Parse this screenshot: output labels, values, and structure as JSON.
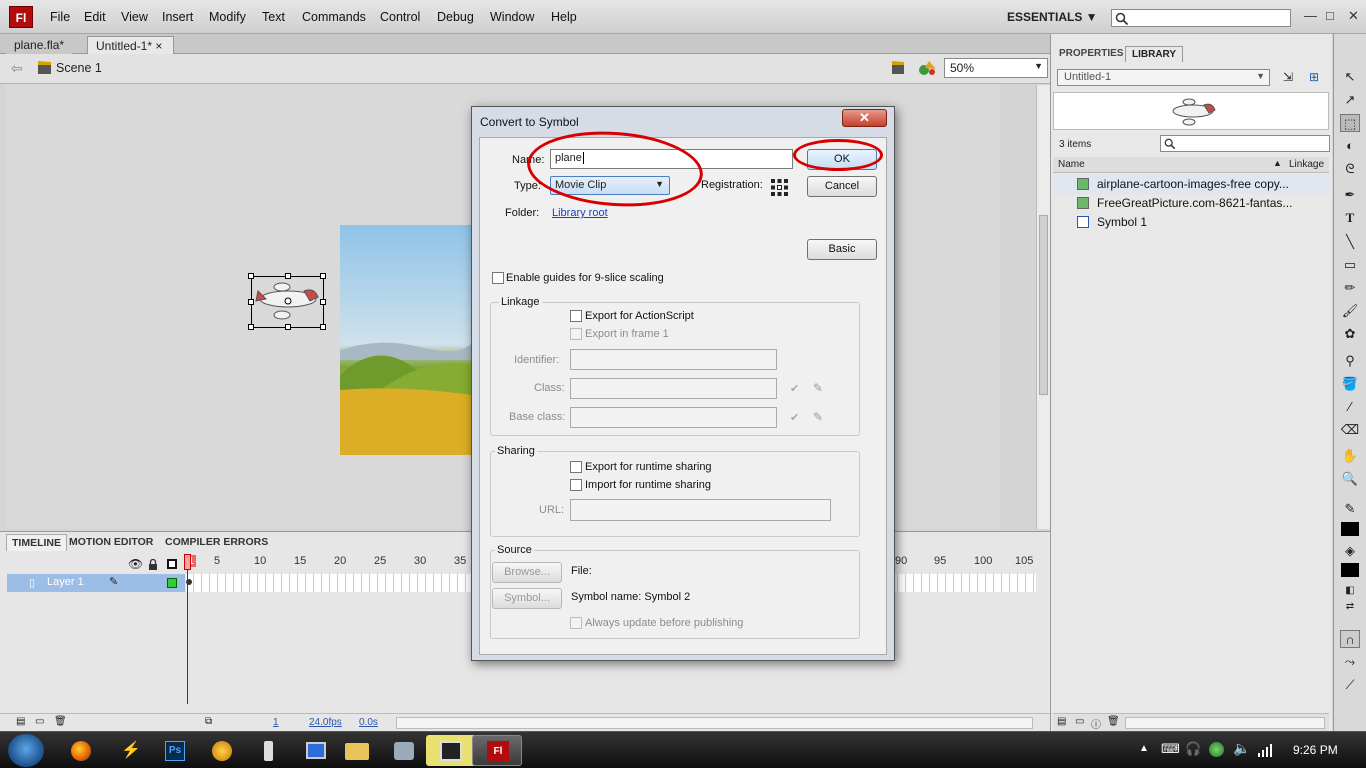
{
  "app": {
    "logo_text": "Fl"
  },
  "menu": [
    "File",
    "Edit",
    "View",
    "Insert",
    "Modify",
    "Text",
    "Commands",
    "Control",
    "Debug",
    "Window",
    "Help"
  ],
  "workspace": {
    "label": "ESSENTIALS ▼"
  },
  "window_controls": {
    "minimize": "—",
    "maximize": "□",
    "close": "✕"
  },
  "doc_tabs": [
    {
      "label": "plane.fla*"
    },
    {
      "label": "Untitled-1*",
      "close": "×"
    }
  ],
  "scene": {
    "label": "Scene 1"
  },
  "zoom": {
    "value": "50%"
  },
  "timeline": {
    "tabs": [
      "TIMELINE",
      "MOTION EDITOR",
      "COMPILER ERRORS"
    ],
    "layer_name": "Layer 1",
    "frame_numbers_left": [
      "1",
      "5",
      "10",
      "15",
      "20",
      "25",
      "30",
      "35"
    ],
    "frame_numbers_right": [
      "90",
      "95",
      "100",
      "105"
    ],
    "current_frame": "1",
    "fps": "24.0fps",
    "time": "0.0s"
  },
  "panel": {
    "tabs": [
      "PROPERTIES",
      "LIBRARY"
    ],
    "document": "Untitled-1",
    "item_count": "3 items",
    "col_name": "Name",
    "col_linkage": "Linkage",
    "items": [
      {
        "name": "airplane-cartoon-images-free copy..."
      },
      {
        "name": "FreeGreatPicture.com-8621-fantas..."
      },
      {
        "name": "Symbol 1"
      }
    ]
  },
  "dialog": {
    "title": "Convert to Symbol",
    "name_label": "Name:",
    "name_value": "plane",
    "type_label": "Type:",
    "type_value": "Movie Clip",
    "registration_label": "Registration:",
    "folder_label": "Folder:",
    "folder_value": "Library root",
    "ok": "OK",
    "cancel": "Cancel",
    "basic": "Basic",
    "nine_slice": "Enable guides for 9-slice scaling",
    "linkage_label": "Linkage",
    "export_as": "Export for ActionScript",
    "export_frame1": "Export in frame 1",
    "identifier": "Identifier:",
    "class": "Class:",
    "base_class": "Base class:",
    "sharing_label": "Sharing",
    "export_runtime": "Export for runtime sharing",
    "import_runtime": "Import for runtime sharing",
    "url": "URL:",
    "source_label": "Source",
    "browse": "Browse...",
    "file": "File:",
    "symbol_btn": "Symbol...",
    "symbol_name": "Symbol name: Symbol 2",
    "always_update": "Always update before publishing"
  },
  "taskbar": {
    "clock": "9:26 PM"
  },
  "colors": {
    "annotation_red": "#d60000",
    "layer_highlight": "#9bbde6",
    "flash_red": "#b30c0c"
  }
}
